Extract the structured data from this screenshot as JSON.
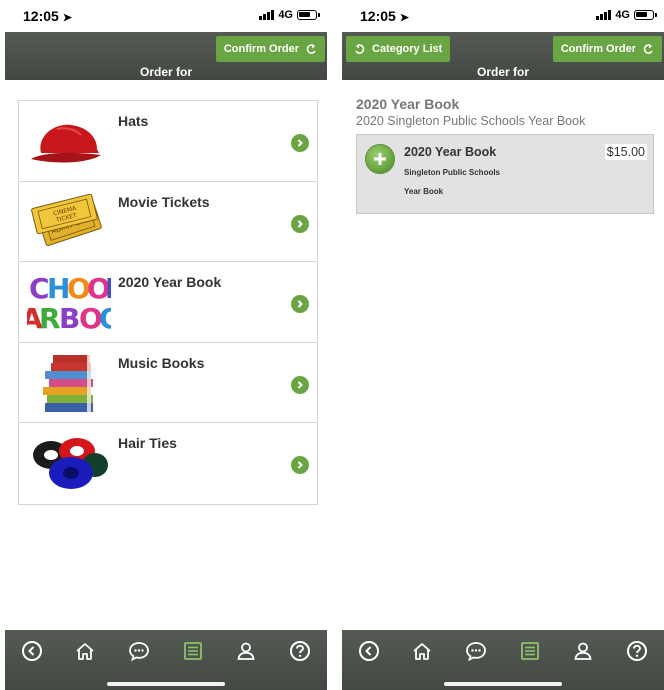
{
  "status": {
    "time": "12:05",
    "network": "4G"
  },
  "left_screen": {
    "header": {
      "confirm_label": "Confirm Order",
      "title": "Order for"
    },
    "categories": [
      {
        "name": "Hats",
        "icon": "red-cap-image"
      },
      {
        "name": "Movie Tickets",
        "icon": "cinema-ticket-image"
      },
      {
        "name": "2020 Year Book",
        "icon": "school-yearbook-text-image"
      },
      {
        "name": "Music Books",
        "icon": "book-stack-image"
      },
      {
        "name": "Hair Ties",
        "icon": "scrunchies-image"
      }
    ]
  },
  "right_screen": {
    "header": {
      "category_label": "Category List",
      "confirm_label": "Confirm Order",
      "title": "Order for"
    },
    "product_title": "2020 Year Book",
    "product_subtitle": "2020 Singleton Public Schools Year Book",
    "item": {
      "name": "2020 Year Book",
      "line1": "Singleton Public Schools",
      "line2": "Year Book",
      "price": "$15.00"
    }
  },
  "tabbar": {
    "tabs": [
      "back-icon",
      "home-icon",
      "chat-icon",
      "order-list-icon",
      "user-icon",
      "help-icon"
    ],
    "active": "order-list-icon",
    "active_color": "#8cc36a",
    "icon_color": "#ffffff"
  },
  "colors": {
    "accent": "#6aa544",
    "header": "#4a4f4a"
  }
}
